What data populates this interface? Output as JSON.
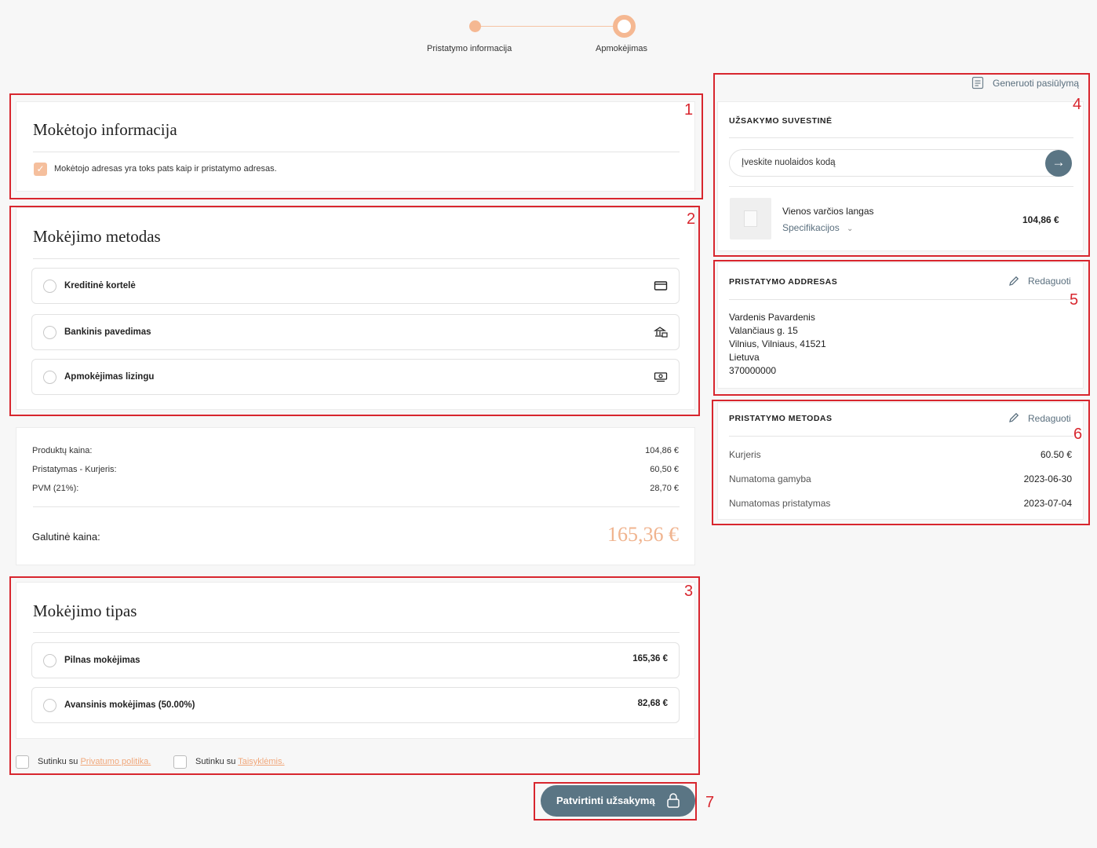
{
  "stepper": {
    "step1": "Pristatymo informacija",
    "step2": "Apmokėjimas"
  },
  "payer": {
    "title": "Mokėtojo informacija",
    "same_address_label": "Mokėtojo adresas yra toks pats kaip ir pristatymo adresas.",
    "badge": "1"
  },
  "payment_method": {
    "title": "Mokėjimo metodas",
    "badge": "2",
    "options": [
      {
        "label": "Kreditinė kortelė",
        "icon": "credit-card-icon"
      },
      {
        "label": "Bankinis pavedimas",
        "icon": "bank-icon"
      },
      {
        "label": "Apmokėjimas lizingu",
        "icon": "cash-icon"
      }
    ]
  },
  "prices": {
    "products_label": "Produktų kaina:",
    "products_value": "104,86 €",
    "delivery_label": "Pristatymas - Kurjeris:",
    "delivery_value": "60,50 €",
    "vat_label": "PVM (21%):",
    "vat_value": "28,70 €",
    "total_label": "Galutinė kaina:",
    "total_value": "165,36 €",
    "total_color": "#f0b48f"
  },
  "payment_type": {
    "title": "Mokėjimo tipas",
    "badge": "3",
    "options": [
      {
        "label": "Pilnas mokėjimas",
        "value": "165,36 €"
      },
      {
        "label": "Avansinis mokėjimas (50.00%)",
        "value": "82,68 €"
      }
    ]
  },
  "consent": {
    "agree1_prefix": "Sutinku su",
    "agree1_link": "Privatumo politika.",
    "agree2_prefix": "Sutinku su",
    "agree2_link": "Taisyklėmis.",
    "link_color": "#f0a77a"
  },
  "submit": {
    "label": "Patvirtinti užsakymą",
    "badge": "7",
    "color": "#5a7584"
  },
  "summary": {
    "generate_label": "Generuoti pasiūlymą",
    "title": "UŽSAKYMO SUVESTINĖ",
    "badge": "4",
    "discount_placeholder": "Įveskite nuolaidos kodą",
    "item_name": "Vienos varčios langas",
    "item_spec": "Specifikacijos",
    "item_price": "104,86 €"
  },
  "delivery_address": {
    "title": "PRISTATYMO ADDRESAS",
    "edit_label": "Redaguoti",
    "badge": "5",
    "lines": [
      "Vardenis Pavardenis",
      "Valančiaus g. 15",
      "Vilnius, Vilniaus, 41521",
      "Lietuva",
      "370000000"
    ]
  },
  "delivery_method": {
    "title": "PRISTATYMO METODAS",
    "edit_label": "Redaguoti",
    "badge": "6",
    "rows": [
      {
        "label": "Kurjeris",
        "value": "60.50 €"
      },
      {
        "label": "Numatoma gamyba",
        "value": "2023-06-30"
      },
      {
        "label": "Numatomas pristatymas",
        "value": "2023-07-04"
      }
    ]
  },
  "highlight_color": "#d8262e"
}
